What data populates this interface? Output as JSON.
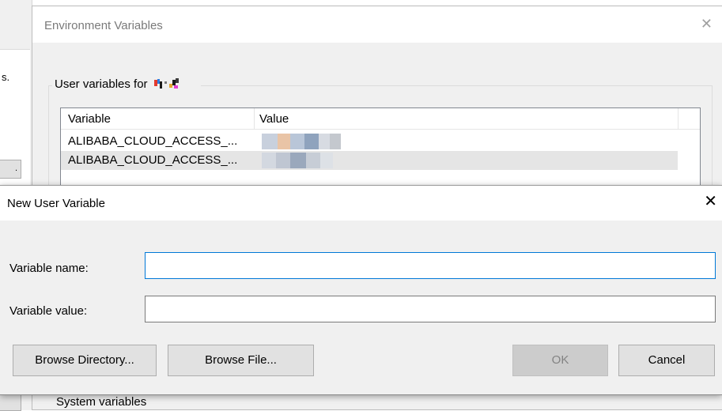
{
  "background_window": {
    "text_fragment": "s.",
    "button_fragment": "."
  },
  "env_window": {
    "title": "Environment Variables",
    "close_glyph": "✕",
    "user_group_label": "User variables for",
    "user_icon": "pixelated-user-name-icon",
    "list": {
      "columns": [
        "Variable",
        "Value"
      ],
      "rows": [
        {
          "variable": "ALIBABA_CLOUD_ACCESS_...",
          "value_icon": "blurred-value"
        },
        {
          "variable": "ALIBABA_CLOUD_ACCESS_...",
          "value_icon": "blurred-value"
        }
      ]
    },
    "system_group_label": "System variables"
  },
  "dialog": {
    "title": "New User Variable",
    "close_glyph": "✕",
    "fields": {
      "name": {
        "label": "Variable name:",
        "value": "",
        "placeholder": ""
      },
      "value": {
        "label": "Variable value:",
        "value": "",
        "placeholder": ""
      }
    },
    "buttons": {
      "browse_directory": "Browse Directory...",
      "browse_file": "Browse File...",
      "ok": "OK",
      "cancel": "Cancel"
    },
    "colors": {
      "focus_border": "#0078d7",
      "disabled_text": "#838383"
    }
  }
}
